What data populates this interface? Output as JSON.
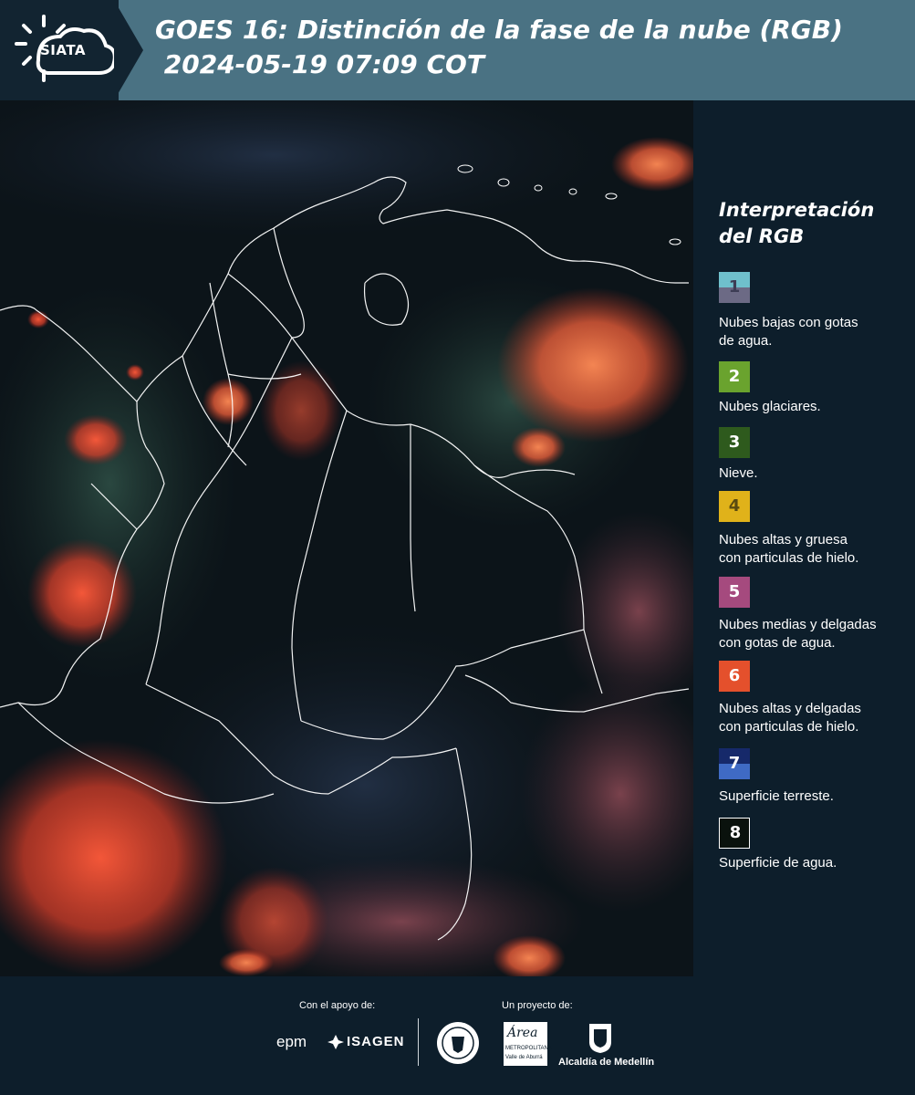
{
  "header": {
    "logo_text": "SIATA",
    "title_line1": "GOES 16: Distinción de la fase de la nube (RGB)",
    "title_line2": " 2024-05-19 07:09 COT",
    "background_color": "#4a7283"
  },
  "legend": {
    "title_line1": "Interpretación",
    "title_line2": "del RGB",
    "items": [
      {
        "number": "1",
        "label_line1": "Nubes bajas con gotas",
        "label_line2": "de agua.",
        "color_top": "#6fc0cc",
        "color_bottom": "#6c6a85"
      },
      {
        "number": "2",
        "label_line1": "Nubes glaciares.",
        "label_line2": "",
        "color": "#6aa32e"
      },
      {
        "number": "3",
        "label_line1": "Nieve.",
        "label_line2": "",
        "color": "#2e5a1d"
      },
      {
        "number": "4",
        "label_line1": "Nubes altas y gruesa",
        "label_line2": "con particulas de hielo.",
        "color": "#e0b21a"
      },
      {
        "number": "5",
        "label_line1": "Nubes medias y delgadas",
        "label_line2": "con gotas de agua.",
        "color": "#a54a7e"
      },
      {
        "number": "6",
        "label_line1": "Nubes altas y delgadas",
        "label_line2": "con particulas de hielo.",
        "color": "#e4502c"
      },
      {
        "number": "7",
        "label_line1": "Superficie terreste.",
        "label_line2": "",
        "color_top": "#16296a",
        "color_bottom": "#3f6ac4"
      },
      {
        "number": "8",
        "label_line1": "Superficie de agua.",
        "label_line2": "",
        "color": "#0a120d"
      }
    ]
  },
  "footer": {
    "support_label": "Con el apoyo de:",
    "project_label": "Un proyecto de:",
    "sponsor1": "epm",
    "sponsor2": "ISAGEN",
    "partner_area_1": "Área",
    "partner_area_2": "METROPOLITANA",
    "partner_area_3": "Valle de Aburrá",
    "partner_alcaldia": "Alcaldía de Medellín"
  },
  "icons": {
    "logo": "sun-cloud-icon",
    "seal": "seal-icon",
    "coat_of_arms": "coat-of-arms-icon"
  }
}
